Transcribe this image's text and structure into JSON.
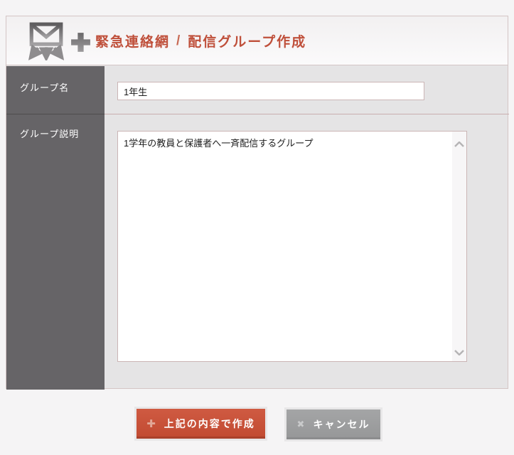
{
  "header": {
    "breadcrumb": {
      "section": "緊急連絡網",
      "separator": "/",
      "page": "配信グループ作成"
    },
    "icons": {
      "mail_broadcast": "mail-broadcast-icon",
      "plus": "plus-icon"
    }
  },
  "form": {
    "group_name": {
      "label": "グループ名",
      "value": "1年生"
    },
    "group_description": {
      "label": "グループ説明",
      "value": "1学年の教員と保護者へ一斉配信するグループ"
    }
  },
  "buttons": {
    "create": {
      "label": "上記の内容で作成",
      "icon": "✚"
    },
    "cancel": {
      "label": "キャンセル",
      "icon": "✖"
    }
  },
  "colors": {
    "accent": "#bf4f3a",
    "create_button": "#c14a31",
    "cancel_button": "#9b9c9d",
    "label_column": "#666467",
    "panel_border": "#d4c5c5",
    "field_border": "#cbb5b5",
    "content_background": "#e5e4e5"
  }
}
